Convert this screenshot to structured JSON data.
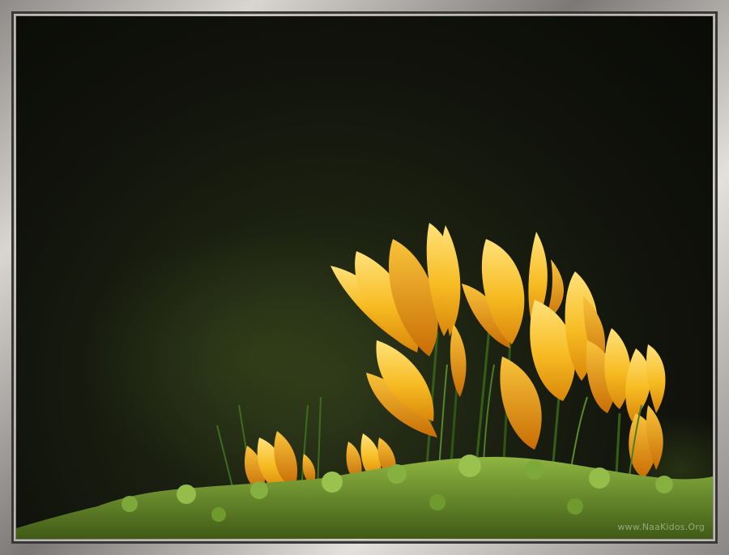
{
  "image": {
    "subject": "yellow-crocus-flowers",
    "watermark": "www.NaaKidos.Org"
  },
  "colors": {
    "background": "#0f110a",
    "petal_light": "#ffd75a",
    "petal_mid": "#f6b21c",
    "petal_dark": "#d47a05",
    "moss": "#6f9a2e",
    "frame": "#9a9794"
  }
}
